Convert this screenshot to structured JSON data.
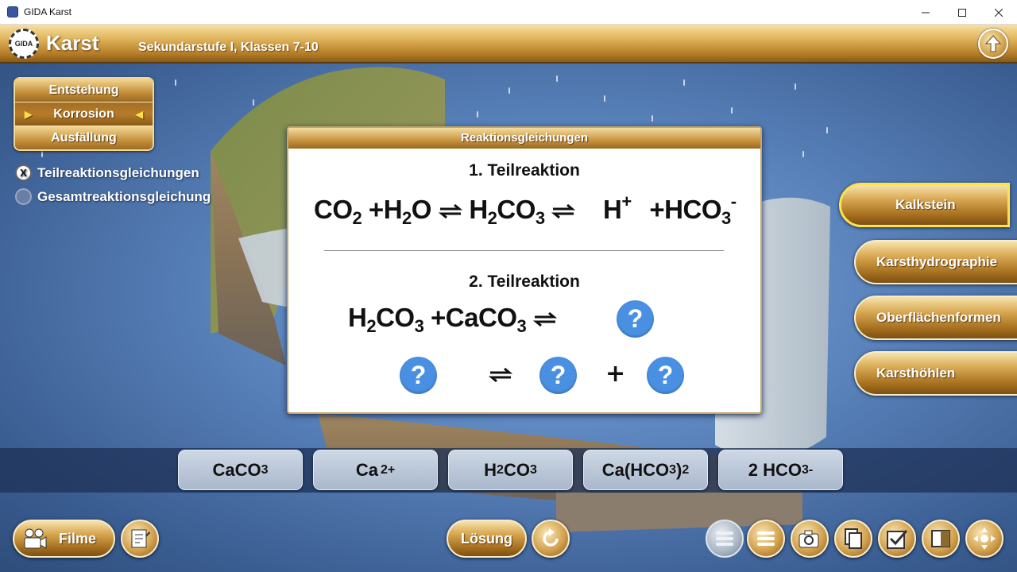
{
  "window": {
    "title": "GIDA Karst"
  },
  "header": {
    "logo_text": "GIDA",
    "app_name": "Karst",
    "subtitle": "Sekundarstufe I, Klassen 7-10"
  },
  "topic_nav": [
    {
      "label": "Entstehung",
      "active": false
    },
    {
      "label": "Korrosion",
      "active": true
    },
    {
      "label": "Ausfällung",
      "active": false
    }
  ],
  "view_options": [
    {
      "label": "Teilreaktionsgleichungen",
      "selected": true,
      "mark": "X"
    },
    {
      "label": "Gesamtreaktionsgleichung",
      "selected": false
    }
  ],
  "side_buttons": [
    {
      "label": "Kalkstein",
      "active": true
    },
    {
      "label": "Karsthydrographie",
      "active": false
    },
    {
      "label": "Oberflächenformen",
      "active": false
    },
    {
      "label": "Karsthöhlen",
      "active": false
    }
  ],
  "panel": {
    "title": "Reaktionsgleichungen",
    "reaction1_title": "1. Teilreaktion",
    "reaction2_title": "2. Teilreaktion",
    "eq1": {
      "a": "CO",
      "a_sub": "2",
      "plus1": "+",
      "b": "H",
      "b_sub": "2",
      "b_tail": "O",
      "c": "H",
      "c_sub": "2",
      "c_tail": "CO",
      "c_sub2": "3",
      "d": "H",
      "d_sup": "+",
      "plus2": "+",
      "e": "HCO",
      "e_sub": "3",
      "e_sup": "-"
    },
    "eq2": {
      "a": "H",
      "a_sub": "2",
      "a_tail": "CO",
      "a_sub2": "3",
      "plus": "+",
      "b": "CaCO",
      "b_sub": "3"
    },
    "unknown": "?",
    "plus": "+"
  },
  "answers": [
    {
      "main": "CaCO",
      "sub": "3",
      "sup": ""
    },
    {
      "main": "Ca",
      "sub": "",
      "sup": "2+"
    },
    {
      "pre": "H",
      "pre_sub": "2",
      "main": "CO",
      "sub": "3"
    },
    {
      "main": "Ca(HCO",
      "sub": "3",
      "tail": ")",
      "tail_sub": "2"
    },
    {
      "main": "2 HCO",
      "sub": "3",
      "sup": "-"
    }
  ],
  "toolbar": {
    "films_label": "Filme",
    "solution_label": "Lösung"
  },
  "icons": {
    "up": "arrow-up-icon",
    "films": "film-camera-icon",
    "notes": "notepad-icon",
    "reset": "refresh-icon",
    "toolbar_right": [
      "list-icon",
      "list-icon",
      "camera-icon",
      "copy-icon",
      "checkbox-icon",
      "split-view-icon",
      "navigation-icon"
    ]
  },
  "colors": {
    "gold": "#d9a954",
    "question": "#4a90e2",
    "tray": "#2e4d7b"
  }
}
